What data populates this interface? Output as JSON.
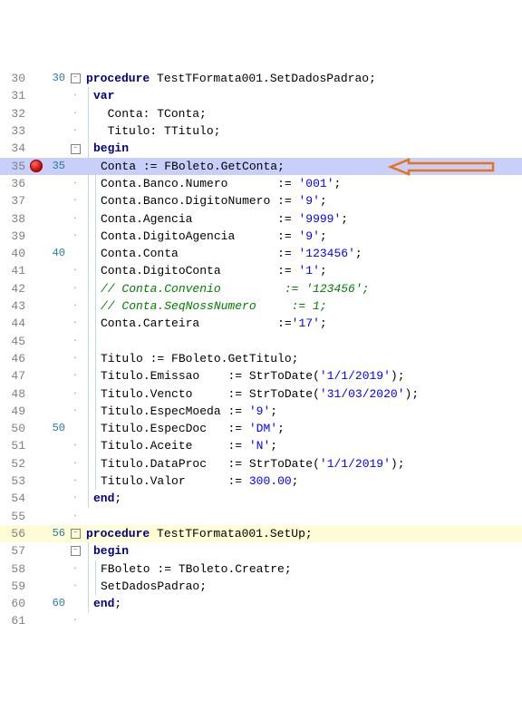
{
  "rows": [
    {
      "n1": "30",
      "n2": "30",
      "fold": "min",
      "parts": [
        {
          "c": "kw",
          "t": "procedure"
        },
        {
          "c": "id",
          "t": " TestTFormata001"
        },
        {
          "c": "pun",
          "t": "."
        },
        {
          "c": "id",
          "t": "SetDadosPadrao"
        },
        {
          "c": "pun",
          "t": ";"
        }
      ],
      "ind": 0
    },
    {
      "n1": "31",
      "n2": "",
      "parts": [
        {
          "c": "kw",
          "t": "var"
        }
      ],
      "ind": 1,
      "bar1": true
    },
    {
      "n1": "32",
      "n2": "",
      "parts": [
        {
          "c": "id",
          "t": "Conta"
        },
        {
          "c": "pun",
          "t": ": "
        },
        {
          "c": "id",
          "t": "TConta"
        },
        {
          "c": "pun",
          "t": ";"
        }
      ],
      "ind": 2,
      "bar1": true
    },
    {
      "n1": "33",
      "n2": "",
      "parts": [
        {
          "c": "id",
          "t": "Titulo"
        },
        {
          "c": "pun",
          "t": ": "
        },
        {
          "c": "id",
          "t": "TTitulo"
        },
        {
          "c": "pun",
          "t": ";"
        }
      ],
      "ind": 2,
      "bar1": true
    },
    {
      "n1": "34",
      "n2": "",
      "fold": "min",
      "parts": [
        {
          "c": "kw",
          "t": "begin"
        }
      ],
      "ind": 1,
      "bar1": true
    },
    {
      "n1": "35",
      "n2": "35",
      "bp": true,
      "hl": "line",
      "arrow": true,
      "parts": [
        {
          "c": "id",
          "t": "Conta "
        },
        {
          "c": "pun",
          "t": ":= "
        },
        {
          "c": "id",
          "t": "FBoleto"
        },
        {
          "c": "pun",
          "t": "."
        },
        {
          "c": "id",
          "t": "GetConta"
        },
        {
          "c": "pun",
          "t": ";"
        }
      ],
      "ind": 2,
      "bar1": true,
      "bar2": true
    },
    {
      "n1": "36",
      "n2": "",
      "parts": [
        {
          "c": "id",
          "t": "Conta"
        },
        {
          "c": "pun",
          "t": "."
        },
        {
          "c": "id",
          "t": "Banco"
        },
        {
          "c": "pun",
          "t": "."
        },
        {
          "c": "id",
          "t": "Numero       "
        },
        {
          "c": "pun",
          "t": ":= "
        },
        {
          "c": "str",
          "t": "'001'"
        },
        {
          "c": "pun",
          "t": ";"
        }
      ],
      "ind": 2,
      "bar1": true,
      "bar2": true
    },
    {
      "n1": "37",
      "n2": "",
      "parts": [
        {
          "c": "id",
          "t": "Conta"
        },
        {
          "c": "pun",
          "t": "."
        },
        {
          "c": "id",
          "t": "Banco"
        },
        {
          "c": "pun",
          "t": "."
        },
        {
          "c": "id",
          "t": "DigitoNumero "
        },
        {
          "c": "pun",
          "t": ":= "
        },
        {
          "c": "str",
          "t": "'9'"
        },
        {
          "c": "pun",
          "t": ";"
        }
      ],
      "ind": 2,
      "bar1": true,
      "bar2": true
    },
    {
      "n1": "38",
      "n2": "",
      "parts": [
        {
          "c": "id",
          "t": "Conta"
        },
        {
          "c": "pun",
          "t": "."
        },
        {
          "c": "id",
          "t": "Agencia            "
        },
        {
          "c": "pun",
          "t": ":= "
        },
        {
          "c": "str",
          "t": "'9999'"
        },
        {
          "c": "pun",
          "t": ";"
        }
      ],
      "ind": 2,
      "bar1": true,
      "bar2": true
    },
    {
      "n1": "39",
      "n2": "",
      "parts": [
        {
          "c": "id",
          "t": "Conta"
        },
        {
          "c": "pun",
          "t": "."
        },
        {
          "c": "id",
          "t": "DigitoAgencia      "
        },
        {
          "c": "pun",
          "t": ":= "
        },
        {
          "c": "str",
          "t": "'9'"
        },
        {
          "c": "pun",
          "t": ";"
        }
      ],
      "ind": 2,
      "bar1": true,
      "bar2": true
    },
    {
      "n1": "40",
      "n2": "40",
      "parts": [
        {
          "c": "id",
          "t": "Conta"
        },
        {
          "c": "pun",
          "t": "."
        },
        {
          "c": "id",
          "t": "Conta              "
        },
        {
          "c": "pun",
          "t": ":= "
        },
        {
          "c": "str",
          "t": "'123456'"
        },
        {
          "c": "pun",
          "t": ";"
        }
      ],
      "ind": 2,
      "bar1": true,
      "bar2": true
    },
    {
      "n1": "41",
      "n2": "",
      "parts": [
        {
          "c": "id",
          "t": "Conta"
        },
        {
          "c": "pun",
          "t": "."
        },
        {
          "c": "id",
          "t": "DigitoConta        "
        },
        {
          "c": "pun",
          "t": ":= "
        },
        {
          "c": "str",
          "t": "'1'"
        },
        {
          "c": "pun",
          "t": ";"
        }
      ],
      "ind": 2,
      "bar1": true,
      "bar2": true
    },
    {
      "n1": "42",
      "n2": "",
      "parts": [
        {
          "c": "cmt",
          "t": "// Conta.Convenio         := '123456';"
        }
      ],
      "ind": 2,
      "bar1": true,
      "bar2": true
    },
    {
      "n1": "43",
      "n2": "",
      "parts": [
        {
          "c": "cmt",
          "t": "// Conta.SeqNossNumero     := 1;"
        }
      ],
      "ind": 2,
      "bar1": true,
      "bar2": true
    },
    {
      "n1": "44",
      "n2": "",
      "parts": [
        {
          "c": "id",
          "t": "Conta"
        },
        {
          "c": "pun",
          "t": "."
        },
        {
          "c": "id",
          "t": "Carteira           "
        },
        {
          "c": "pun",
          "t": ":="
        },
        {
          "c": "str",
          "t": "'17'"
        },
        {
          "c": "pun",
          "t": ";"
        }
      ],
      "ind": 2,
      "bar1": true,
      "bar2": true
    },
    {
      "n1": "45",
      "n2": "",
      "parts": [],
      "ind": 2,
      "bar1": true,
      "bar2": true
    },
    {
      "n1": "46",
      "n2": "",
      "parts": [
        {
          "c": "id",
          "t": "Titulo "
        },
        {
          "c": "pun",
          "t": ":= "
        },
        {
          "c": "id",
          "t": "FBoleto"
        },
        {
          "c": "pun",
          "t": "."
        },
        {
          "c": "id",
          "t": "GetTitulo"
        },
        {
          "c": "pun",
          "t": ";"
        }
      ],
      "ind": 2,
      "bar1": true,
      "bar2": true
    },
    {
      "n1": "47",
      "n2": "",
      "parts": [
        {
          "c": "id",
          "t": "Titulo"
        },
        {
          "c": "pun",
          "t": "."
        },
        {
          "c": "id",
          "t": "Emissao    "
        },
        {
          "c": "pun",
          "t": ":= "
        },
        {
          "c": "id",
          "t": "StrToDate"
        },
        {
          "c": "pun",
          "t": "("
        },
        {
          "c": "str",
          "t": "'1/1/2019'"
        },
        {
          "c": "pun",
          "t": ");"
        }
      ],
      "ind": 2,
      "bar1": true,
      "bar2": true
    },
    {
      "n1": "48",
      "n2": "",
      "parts": [
        {
          "c": "id",
          "t": "Titulo"
        },
        {
          "c": "pun",
          "t": "."
        },
        {
          "c": "id",
          "t": "Vencto     "
        },
        {
          "c": "pun",
          "t": ":= "
        },
        {
          "c": "id",
          "t": "StrToDate"
        },
        {
          "c": "pun",
          "t": "("
        },
        {
          "c": "str",
          "t": "'31/03/2020'"
        },
        {
          "c": "pun",
          "t": ");"
        }
      ],
      "ind": 2,
      "bar1": true,
      "bar2": true
    },
    {
      "n1": "49",
      "n2": "",
      "parts": [
        {
          "c": "id",
          "t": "Titulo"
        },
        {
          "c": "pun",
          "t": "."
        },
        {
          "c": "id",
          "t": "EspecMoeda "
        },
        {
          "c": "pun",
          "t": ":= "
        },
        {
          "c": "str",
          "t": "'9'"
        },
        {
          "c": "pun",
          "t": ";"
        }
      ],
      "ind": 2,
      "bar1": true,
      "bar2": true
    },
    {
      "n1": "50",
      "n2": "50",
      "parts": [
        {
          "c": "id",
          "t": "Titulo"
        },
        {
          "c": "pun",
          "t": "."
        },
        {
          "c": "id",
          "t": "EspecDoc   "
        },
        {
          "c": "pun",
          "t": ":= "
        },
        {
          "c": "str",
          "t": "'DM'"
        },
        {
          "c": "pun",
          "t": ";"
        }
      ],
      "ind": 2,
      "bar1": true,
      "bar2": true
    },
    {
      "n1": "51",
      "n2": "",
      "parts": [
        {
          "c": "id",
          "t": "Titulo"
        },
        {
          "c": "pun",
          "t": "."
        },
        {
          "c": "id",
          "t": "Aceite     "
        },
        {
          "c": "pun",
          "t": ":= "
        },
        {
          "c": "str",
          "t": "'N'"
        },
        {
          "c": "pun",
          "t": ";"
        }
      ],
      "ind": 2,
      "bar1": true,
      "bar2": true
    },
    {
      "n1": "52",
      "n2": "",
      "parts": [
        {
          "c": "id",
          "t": "Titulo"
        },
        {
          "c": "pun",
          "t": "."
        },
        {
          "c": "id",
          "t": "DataProc   "
        },
        {
          "c": "pun",
          "t": ":= "
        },
        {
          "c": "id",
          "t": "StrToDate"
        },
        {
          "c": "pun",
          "t": "("
        },
        {
          "c": "str",
          "t": "'1/1/2019'"
        },
        {
          "c": "pun",
          "t": ");"
        }
      ],
      "ind": 2,
      "bar1": true,
      "bar2": true
    },
    {
      "n1": "53",
      "n2": "",
      "parts": [
        {
          "c": "id",
          "t": "Titulo"
        },
        {
          "c": "pun",
          "t": "."
        },
        {
          "c": "id",
          "t": "Valor      "
        },
        {
          "c": "pun",
          "t": ":= "
        },
        {
          "c": "num",
          "t": "300.00"
        },
        {
          "c": "pun",
          "t": ";"
        }
      ],
      "ind": 2,
      "bar1": true,
      "bar2": true
    },
    {
      "n1": "54",
      "n2": "",
      "parts": [
        {
          "c": "kw",
          "t": "end"
        },
        {
          "c": "pun",
          "t": ";"
        }
      ],
      "ind": 1,
      "bar1": true
    },
    {
      "n1": "55",
      "n2": "",
      "parts": [],
      "ind": 0
    },
    {
      "n1": "56",
      "n2": "56",
      "fold": "min",
      "hl": "yellow",
      "parts": [
        {
          "c": "kw",
          "t": "procedure"
        },
        {
          "c": "id",
          "t": " TestTFormata001"
        },
        {
          "c": "pun",
          "t": "."
        },
        {
          "c": "id",
          "t": "SetUp"
        },
        {
          "c": "pun",
          "t": ";"
        }
      ],
      "ind": 0
    },
    {
      "n1": "57",
      "n2": "",
      "fold": "min",
      "parts": [
        {
          "c": "kw",
          "t": "begin"
        }
      ],
      "ind": 1,
      "bar1": true
    },
    {
      "n1": "58",
      "n2": "",
      "mod": "yellow",
      "parts": [
        {
          "c": "id",
          "t": "FBoleto "
        },
        {
          "c": "pun",
          "t": ":= "
        },
        {
          "c": "id",
          "t": "TBoleto"
        },
        {
          "c": "pun",
          "t": "."
        },
        {
          "c": "id",
          "t": "Creatre"
        },
        {
          "c": "pun",
          "t": ";"
        }
      ],
      "ind": 2,
      "bar1": true,
      "bar2": true
    },
    {
      "n1": "59",
      "n2": "",
      "mod": "green",
      "parts": [
        {
          "c": "id",
          "t": "SetDadosPadrao"
        },
        {
          "c": "pun",
          "t": ";"
        }
      ],
      "ind": 2,
      "bar1": true,
      "bar2": true
    },
    {
      "n1": "60",
      "n2": "60",
      "parts": [
        {
          "c": "kw",
          "t": "end"
        },
        {
          "c": "pun",
          "t": ";"
        }
      ],
      "ind": 1,
      "bar1": true
    },
    {
      "n1": "61",
      "n2": "",
      "parts": [],
      "ind": 0,
      "bar1": true
    }
  ]
}
